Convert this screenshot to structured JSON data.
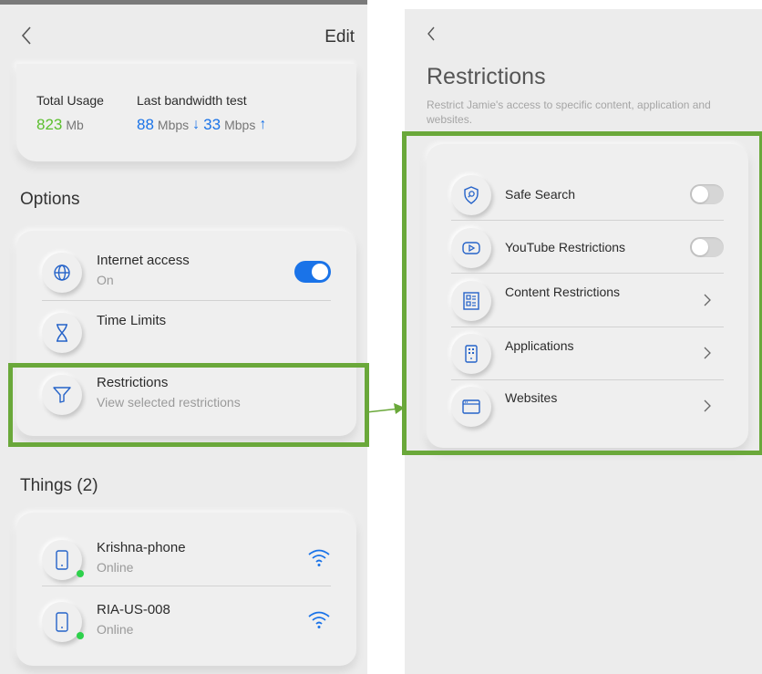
{
  "colors": {
    "accent_blue": "#1a73e8",
    "green": "#5bbf2e",
    "highlight": "#6aa83a",
    "online_dot": "#2dd14b"
  },
  "left": {
    "header": {
      "back_icon": "chevron-left-icon",
      "edit_label": "Edit"
    },
    "usage": {
      "total_label": "Total Usage",
      "total_value": "823",
      "total_unit": "Mb",
      "bandwidth_label": "Last bandwidth test",
      "down_value": "88",
      "down_unit": "Mbps",
      "up_value": "33",
      "up_unit": "Mbps"
    },
    "options_title": "Options",
    "options": [
      {
        "title": "Internet access",
        "subtitle": "On",
        "icon": "globe-icon",
        "control": "toggle-on"
      },
      {
        "title": "Time Limits",
        "subtitle": "",
        "icon": "hourglass-icon"
      },
      {
        "title": "Restrictions",
        "subtitle": "View selected restrictions",
        "icon": "filter-icon"
      }
    ],
    "things_title": "Things (2)",
    "things": [
      {
        "name": "Krishna-phone",
        "status": "Online",
        "icon": "phone-icon"
      },
      {
        "name": "RIA-US-008",
        "status": "Online",
        "icon": "phone-icon"
      }
    ]
  },
  "right": {
    "back_icon": "chevron-left-icon",
    "title": "Restrictions",
    "description": "Restrict Jamie's access to specific content, application and websites.",
    "items": [
      {
        "label": "Safe Search",
        "icon": "shield-search-icon",
        "control": "toggle-off"
      },
      {
        "label": "YouTube Restrictions",
        "icon": "youtube-icon",
        "control": "toggle-off"
      },
      {
        "label": "Content Restrictions",
        "icon": "content-grid-icon",
        "control": "chevron"
      },
      {
        "label": "Applications",
        "icon": "app-device-icon",
        "control": "chevron"
      },
      {
        "label": "Websites",
        "icon": "browser-window-icon",
        "control": "chevron"
      }
    ]
  }
}
